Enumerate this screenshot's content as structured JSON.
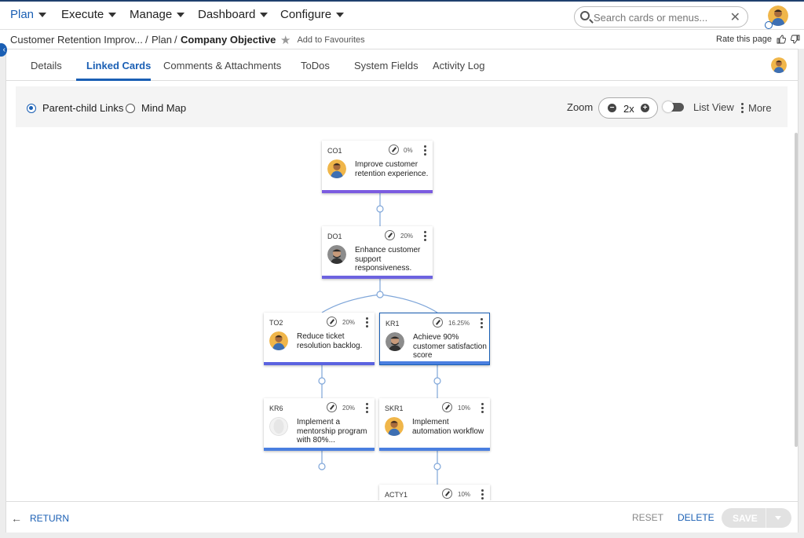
{
  "nav": {
    "items": [
      {
        "label": "Plan"
      },
      {
        "label": "Execute"
      },
      {
        "label": "Manage"
      },
      {
        "label": "Dashboard"
      },
      {
        "label": "Configure"
      }
    ],
    "search_placeholder": "Search cards or menus...",
    "clear_icon": "close-icon"
  },
  "breadcrumb": {
    "parent": "Customer Retention Improv...",
    "section": "Plan",
    "separator": "/",
    "current": "Company Objective",
    "favourite_label": "Add to Favourites",
    "rate_label": "Rate this page"
  },
  "tabs": [
    {
      "label": "Details"
    },
    {
      "label": "Linked Cards"
    },
    {
      "label": "Comments & Attachments"
    },
    {
      "label": "ToDos"
    },
    {
      "label": "System Fields"
    },
    {
      "label": "Activity Log"
    }
  ],
  "active_tab": "Linked Cards",
  "toolbar": {
    "view_options": [
      {
        "label": "Parent-child Links",
        "selected": true
      },
      {
        "label": "Mind Map",
        "selected": false
      }
    ],
    "zoom_label": "Zoom",
    "zoom_value": "2x",
    "list_view_label": "List View",
    "list_view_on": false,
    "more_label": "More"
  },
  "cards": [
    {
      "id": "CO1",
      "progress": "0%",
      "title": "Improve customer retention experience.",
      "avatar": "orange",
      "bar_color": "#7b5ce0"
    },
    {
      "id": "DO1",
      "progress": "20%",
      "title": "Enhance customer support responsiveness.",
      "avatar": "grey",
      "bar_color": "#6d63e0"
    },
    {
      "id": "TO2",
      "progress": "20%",
      "title": "Reduce ticket resolution backlog.",
      "avatar": "orange",
      "bar_color": "#5b63e0"
    },
    {
      "id": "KR1",
      "progress": "16.25%",
      "title": "Achieve 90% customer satisfaction score",
      "avatar": "grey",
      "bar_color": "#4a7fe0"
    },
    {
      "id": "KR6",
      "progress": "20%",
      "title": "Implement a mentorship program with 80%...",
      "avatar": "blank",
      "bar_color": "#4a7fe0"
    },
    {
      "id": "SKR1",
      "progress": "10%",
      "title": "Implement automation workflow",
      "avatar": "orange",
      "bar_color": "#4a7fe0"
    },
    {
      "id": "ACTY1",
      "progress": "10%",
      "title": "",
      "avatar": "none",
      "bar_color": "#4a7fe0"
    }
  ],
  "footer": {
    "return_label": "RETURN",
    "reset_label": "RESET",
    "delete_label": "DELETE",
    "save_label": "SAVE"
  },
  "colors": {
    "accent": "#1a5fb4",
    "connector": "#7fa6d9"
  }
}
